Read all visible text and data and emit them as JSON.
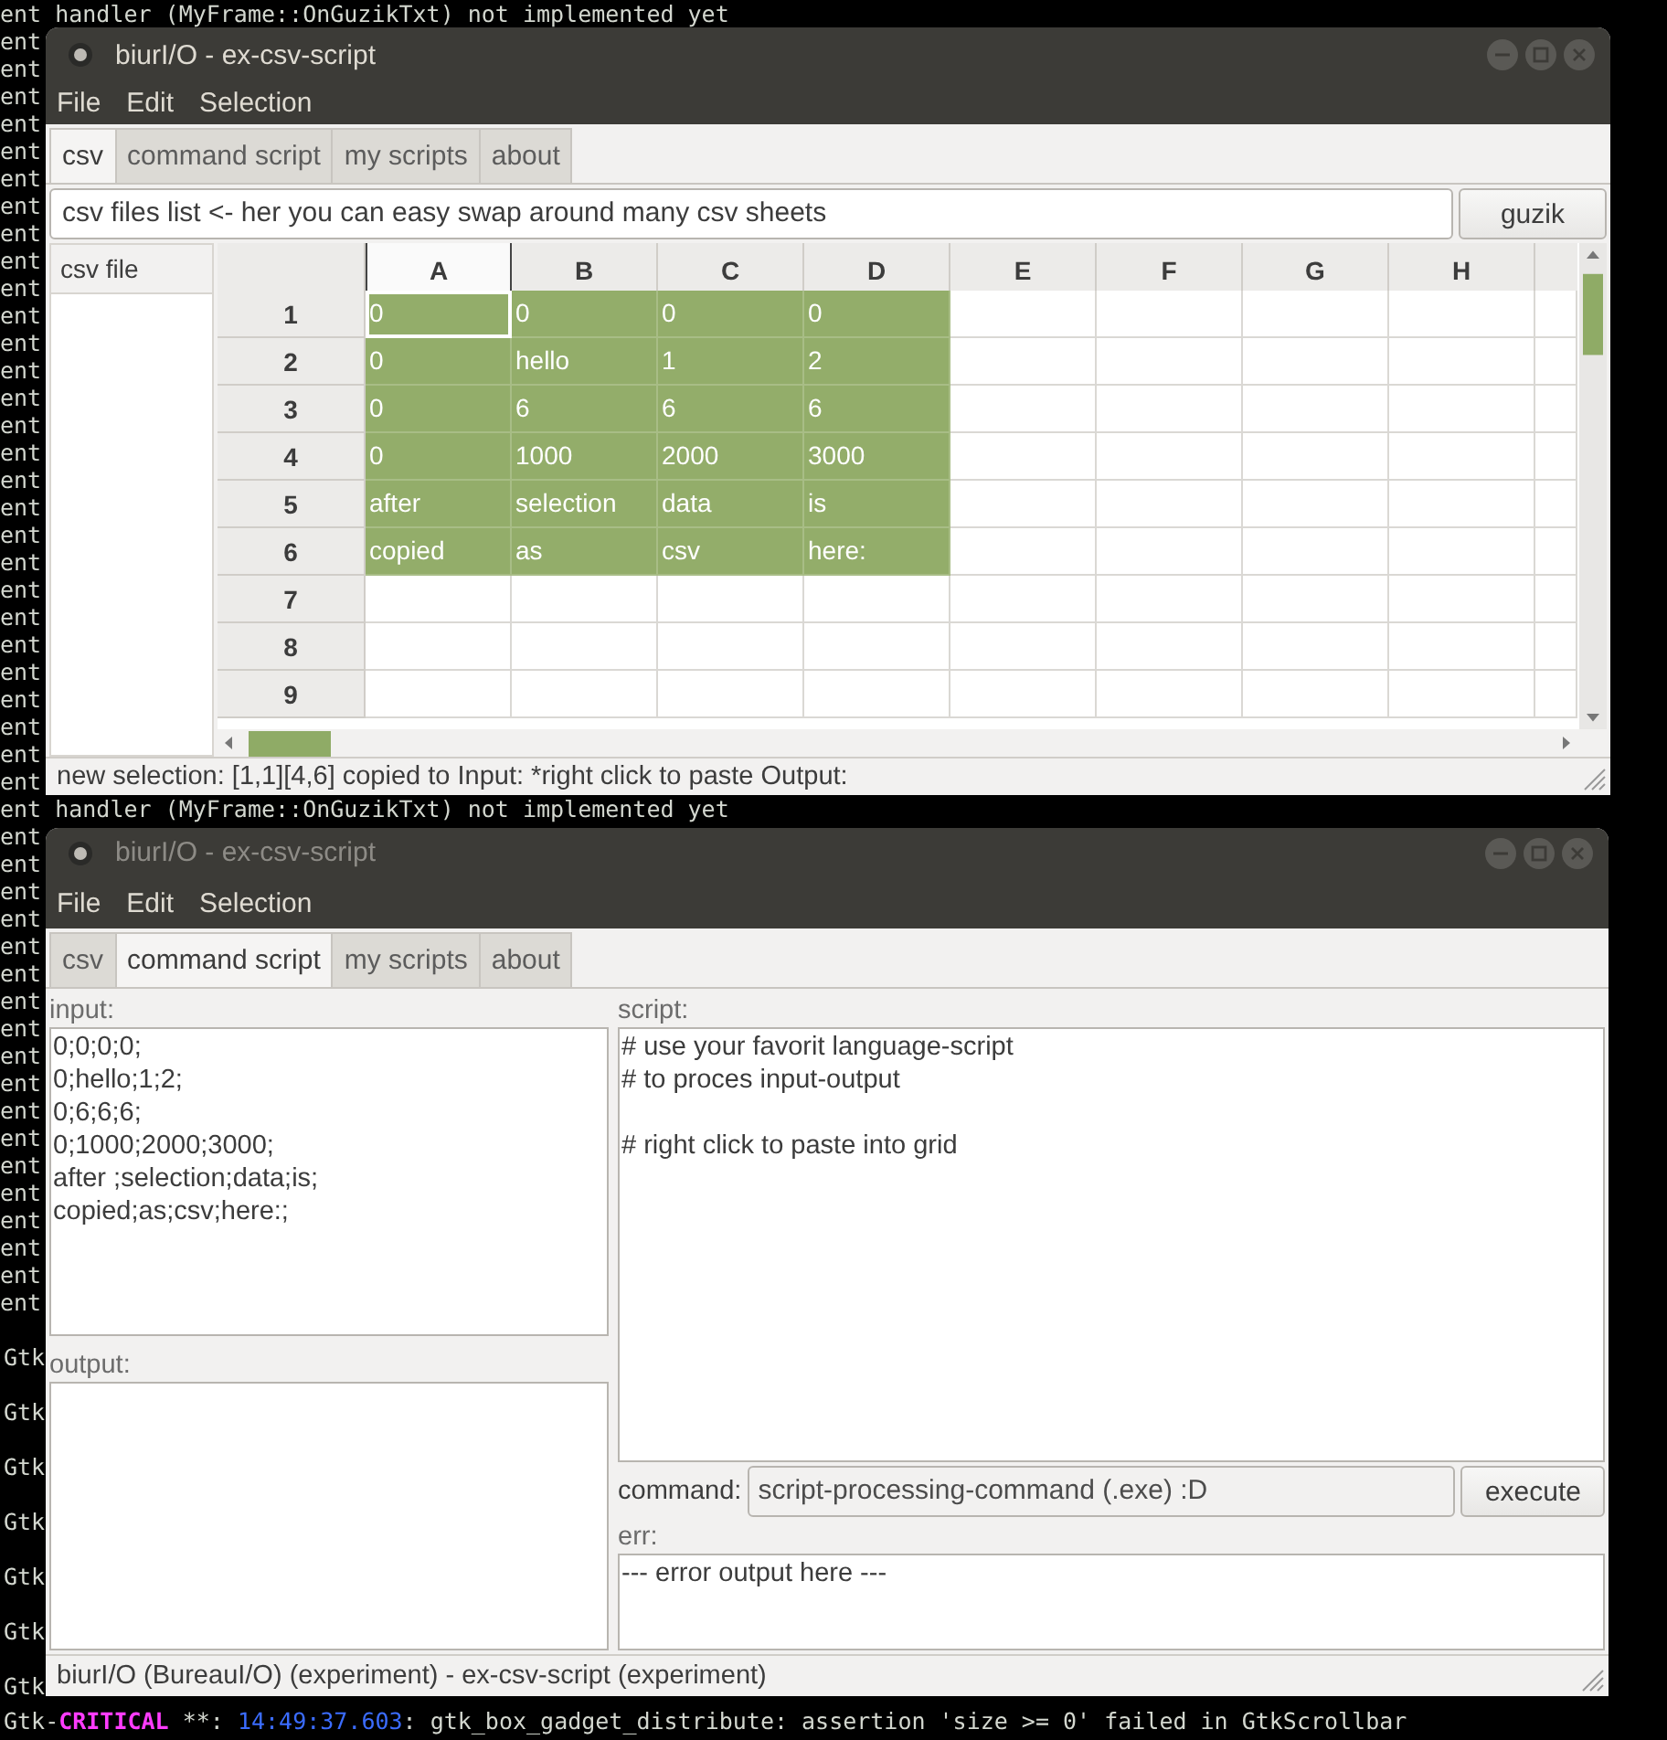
{
  "terminal": {
    "lines": [
      "ent handler (MyFrame::OnGuzikTxt) not implemented yet",
      "ent",
      "ent",
      "ent",
      "ent",
      "ent",
      "ent",
      "ent",
      "ent",
      "ent",
      "ent",
      "ent",
      "ent",
      "ent",
      "ent",
      "ent",
      "ent",
      "ent",
      "ent",
      "ent",
      "ent",
      "ent",
      "ent",
      "ent",
      "ent",
      "ent",
      "ent",
      "ent",
      "ent",
      "ent handler (MyFrame::OnGuzikTxt) not implemented yet",
      "ent",
      "ent",
      "ent",
      "ent",
      "ent",
      "ent",
      "ent",
      "ent",
      "ent",
      "ent",
      "ent",
      "ent",
      "ent",
      "ent",
      "ent",
      "ent",
      "ent",
      "ent"
    ],
    "gtk_lines": [
      "Gtk",
      "Gtk",
      "Gtk",
      "Gtk",
      "Gtk",
      "Gtk",
      "Gtk"
    ],
    "last_line": {
      "prefix": "Gtk-",
      "level": "CRITICAL",
      "stars": " **: ",
      "time": "14:49:37.603",
      "message": ": gtk_box_gadget_distribute: assertion 'size >= 0' failed in GtkScrollbar"
    }
  },
  "windows": [
    {
      "title": "biurI/O - ex-csv-script",
      "active": true,
      "menu": [
        "File",
        "Edit",
        "Selection"
      ],
      "tabs": [
        {
          "label": "csv",
          "selected": true
        },
        {
          "label": "command script",
          "selected": false
        },
        {
          "label": "my scripts",
          "selected": false
        },
        {
          "label": "about",
          "selected": false
        }
      ],
      "page": {
        "kind": "csv",
        "files_field": {
          "value": "csv files list <- her you can easy swap around many csv sheets"
        },
        "button": "guzik",
        "file_list": {
          "header": "csv file"
        },
        "grid": {
          "columns": [
            {
              "label": "A",
              "selected": true
            },
            {
              "label": "B",
              "selected": false
            },
            {
              "label": "C",
              "selected": false
            },
            {
              "label": "D",
              "selected": false
            },
            {
              "label": "E",
              "selected": false
            },
            {
              "label": "F",
              "selected": false
            },
            {
              "label": "G",
              "selected": false
            },
            {
              "label": "H",
              "selected": false
            }
          ],
          "rows": [
            {
              "label": "1",
              "cells": [
                {
                  "text": "0",
                  "selected": true,
                  "current": true
                },
                {
                  "text": "0",
                  "selected": true,
                  "current": false
                },
                {
                  "text": "0",
                  "selected": true,
                  "current": false
                },
                {
                  "text": "0",
                  "selected": true,
                  "current": false
                }
              ]
            },
            {
              "label": "2",
              "cells": [
                {
                  "text": "0",
                  "selected": true,
                  "current": false
                },
                {
                  "text": "hello",
                  "selected": true,
                  "current": false
                },
                {
                  "text": "1",
                  "selected": true,
                  "current": false
                },
                {
                  "text": "2",
                  "selected": true,
                  "current": false
                }
              ]
            },
            {
              "label": "3",
              "cells": [
                {
                  "text": "0",
                  "selected": true,
                  "current": false
                },
                {
                  "text": "6",
                  "selected": true,
                  "current": false
                },
                {
                  "text": "6",
                  "selected": true,
                  "current": false
                },
                {
                  "text": "6",
                  "selected": true,
                  "current": false
                }
              ]
            },
            {
              "label": "4",
              "cells": [
                {
                  "text": "0",
                  "selected": true,
                  "current": false
                },
                {
                  "text": "1000",
                  "selected": true,
                  "current": false
                },
                {
                  "text": "2000",
                  "selected": true,
                  "current": false
                },
                {
                  "text": "3000",
                  "selected": true,
                  "current": false
                }
              ]
            },
            {
              "label": "5",
              "cells": [
                {
                  "text": "after",
                  "selected": true,
                  "current": false
                },
                {
                  "text": "selection",
                  "selected": true,
                  "current": false
                },
                {
                  "text": "data",
                  "selected": true,
                  "current": false
                },
                {
                  "text": "is",
                  "selected": true,
                  "current": false
                }
              ]
            },
            {
              "label": "6",
              "cells": [
                {
                  "text": "copied",
                  "selected": true,
                  "current": false
                },
                {
                  "text": "as",
                  "selected": true,
                  "current": false
                },
                {
                  "text": "csv",
                  "selected": true,
                  "current": false
                },
                {
                  "text": "here:",
                  "selected": true,
                  "current": false
                }
              ]
            },
            {
              "label": "7"
            },
            {
              "label": "8"
            },
            {
              "label": "9"
            }
          ]
        }
      },
      "status": "new selection: [1,1][4,6] copied to Input: *right click to paste Output:"
    },
    {
      "title": "biurI/O - ex-csv-script",
      "active": false,
      "menu": [
        "File",
        "Edit",
        "Selection"
      ],
      "tabs": [
        {
          "label": "csv",
          "selected": false
        },
        {
          "label": "command script",
          "selected": true
        },
        {
          "label": "my scripts",
          "selected": false
        },
        {
          "label": "about",
          "selected": false
        }
      ],
      "page": {
        "kind": "script",
        "input_label": "input:",
        "input": "0;0;0;0;\n0;hello;1;2;\n0;6;6;6;\n0;1000;2000;3000;\nafter ;selection;data;is;\ncopied;as;csv;here:;",
        "output_label": "output:",
        "script_label": "script:",
        "script": "# use your favorit language-script\n# to proces input-output\n\n# right click to paste into grid",
        "command_label": "command:",
        "command": "script-processing-command (.exe) :D",
        "button": "execute",
        "err_label": "err:",
        "err": "--- error output here ---"
      },
      "status": "biurI/O (BureauI/O) (experiment) - ex-csv-script (experiment)"
    }
  ]
}
